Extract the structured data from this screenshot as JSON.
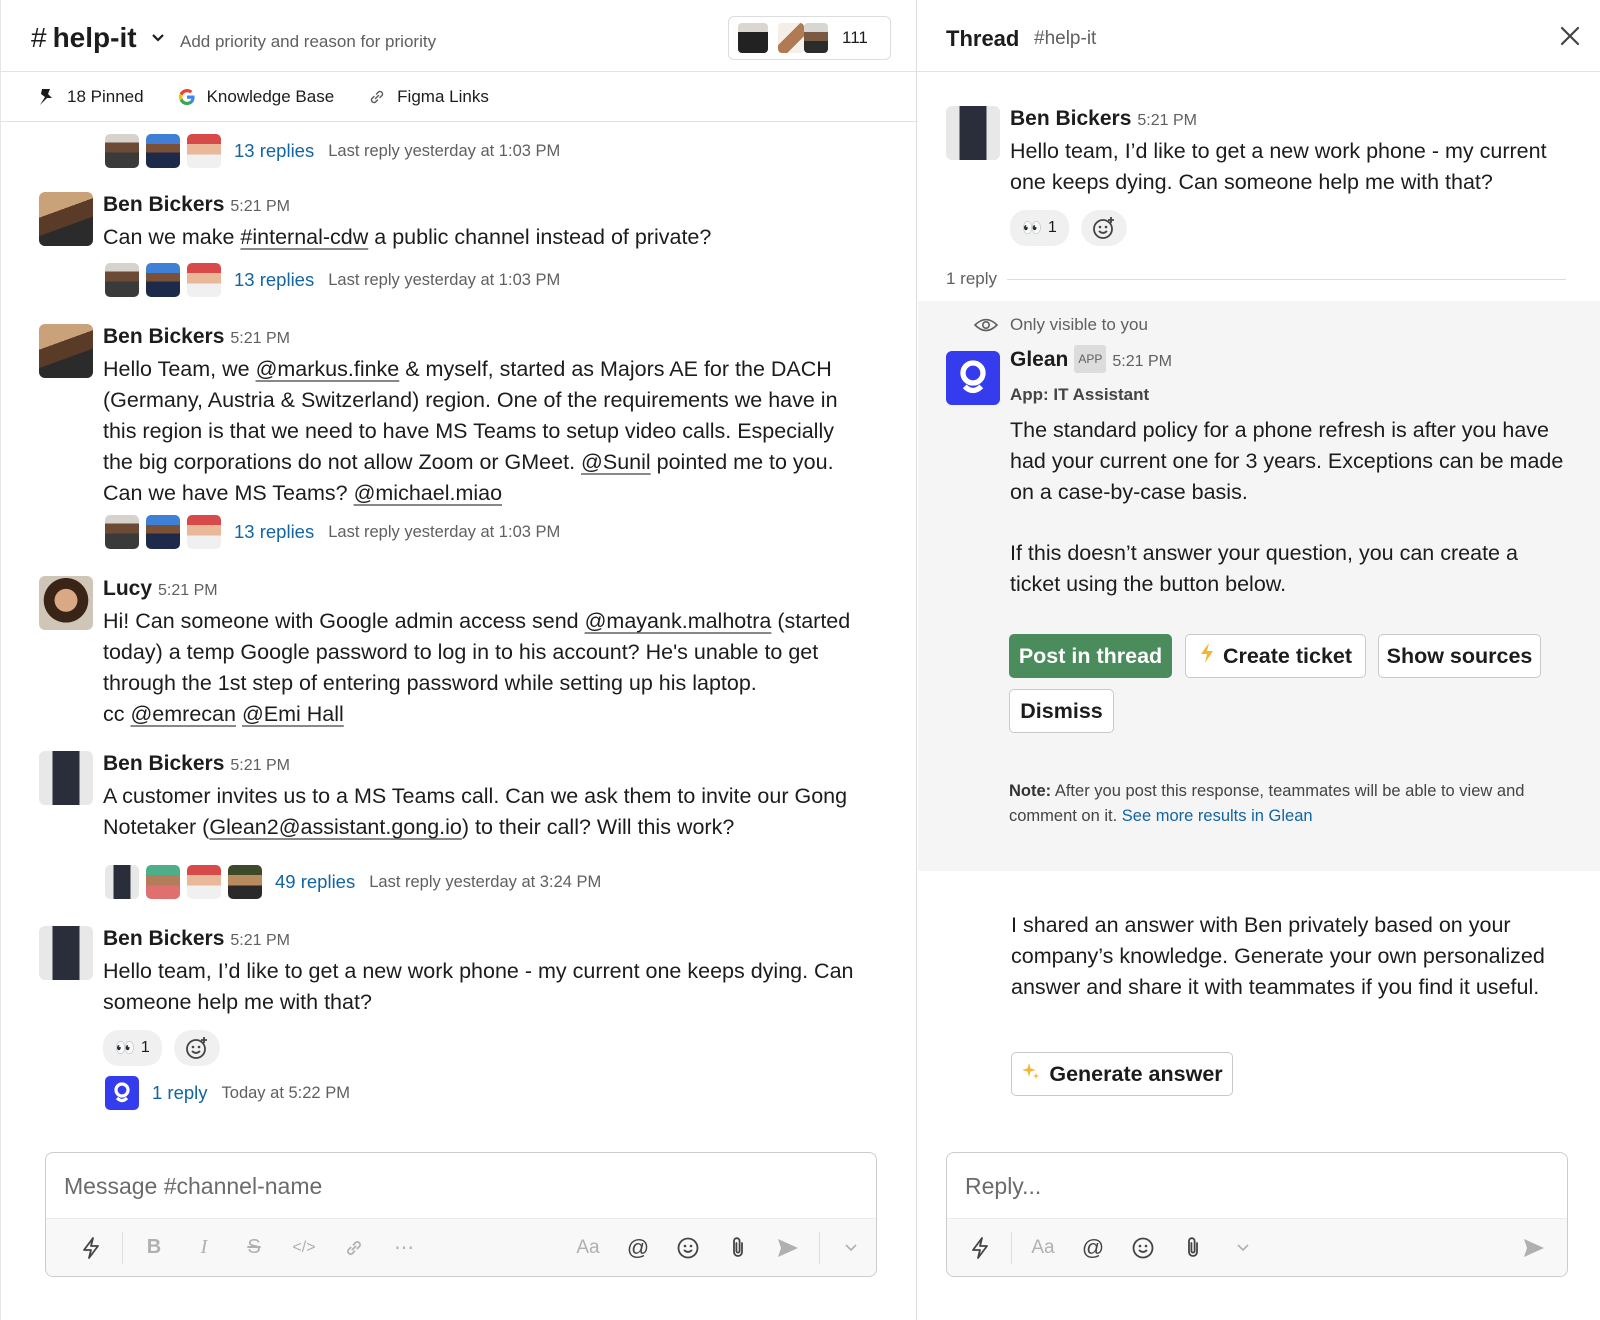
{
  "channel": {
    "name": "help-it",
    "topic": "Add priority and reason for priority",
    "member_count": "111"
  },
  "bookmarks": [
    {
      "label": "18 Pinned",
      "icon": "pin-icon"
    },
    {
      "label": "Knowledge Base",
      "icon": "google-icon"
    },
    {
      "label": "Figma Links",
      "icon": "link-icon"
    }
  ],
  "messages": {
    "m0": {
      "replies": "13 replies",
      "last": "Last reply yesterday at 1:03 PM"
    },
    "m1": {
      "author": "Ben Bickers",
      "time": "5:21 PM",
      "t1": "Can we make ",
      "link": "#internal-cdw",
      "t2": " a public channel instead of private?",
      "replies": "13 replies",
      "last": "Last reply yesterday at 1:03 PM"
    },
    "m2": {
      "author": "Ben Bickers",
      "time": "5:21 PM",
      "t1": "Hello Team, we ",
      "mention1": "@markus.finke",
      "t2": " & myself, started as Majors AE for the DACH (Germany, Austria & Switzerland) region. One of the requirements we have in this region is that we need to have MS Teams to setup video calls. Especially the big corporations do not allow Zoom or GMeet. ",
      "mention2": "@Sunil",
      "t3": " pointed me to you. Can we have MS Teams? ",
      "mention3": "@michael.miao",
      "replies": "13 replies",
      "last": "Last reply yesterday at 1:03 PM"
    },
    "m3": {
      "author": "Lucy",
      "time": "5:21 PM",
      "t1": "Hi! Can someone with Google admin access send ",
      "mention1": "@mayank.malhotra",
      "t2": " (started today) a temp Google password to log in to his account? He's unable to get through the 1st step of entering password while setting up his laptop.",
      "t3": "cc ",
      "mention2": "@emrecan",
      "mention3": "@Emi Hall"
    },
    "m4": {
      "author": "Ben Bickers",
      "time": "5:21 PM",
      "t1": "A customer invites us to a MS Teams call. Can we ask them to invite our Gong Notetaker (",
      "link": "Glean2@assistant.gong.io",
      "t2": ") to their call? Will this work?",
      "replies": "49 replies",
      "last": "Last reply yesterday at 3:24 PM"
    },
    "m5": {
      "author": "Ben Bickers",
      "time": "5:21 PM",
      "text": "Hello team, I’d like to get a new work phone - my current one keeps dying. Can someone help me with that?",
      "reaction_count": "1",
      "replies": "1 reply",
      "last": "Today at 5:22 PM"
    }
  },
  "composer": {
    "placeholder": "Message #channel-name"
  },
  "thread": {
    "title": "Thread",
    "channel": "#help-it",
    "root": {
      "author": "Ben Bickers",
      "time": "5:21 PM",
      "text": "Hello team, I’d like to get a new work phone - my current one keeps dying. Can someone help me with that?",
      "reaction_count": "1"
    },
    "reply_count": "1 reply",
    "ephemeral_note": "Only visible to you",
    "glean": {
      "author": "Glean",
      "badge": "APP",
      "time": "5:21 PM",
      "app_label": "App: IT Assistant",
      "p1": "The standard policy for a phone refresh is after you have had your current one for 3 years. Exceptions can be made on a case-by-case basis.",
      "p2": "If this doesn’t answer your question, you can create a ticket using the button below.",
      "buttons": {
        "post": "Post in thread",
        "create": "Create ticket",
        "sources": "Show sources",
        "dismiss": "Dismiss"
      },
      "note_label": "Note:",
      "note_text": " After you post this response, teammates will be able to view and comment on it. ",
      "note_link": "See more results in Glean"
    },
    "shared": {
      "text": "I shared an answer with Ben privately based on your company’s knowledge. Generate your own personalized answer and share it with teammates if you find it useful.",
      "button": "Generate answer"
    },
    "reply_placeholder": "Reply..."
  },
  "colors": {
    "link": "#1264a3",
    "primary_button": "#4a8c5c",
    "glean_brand": "#343ced"
  }
}
